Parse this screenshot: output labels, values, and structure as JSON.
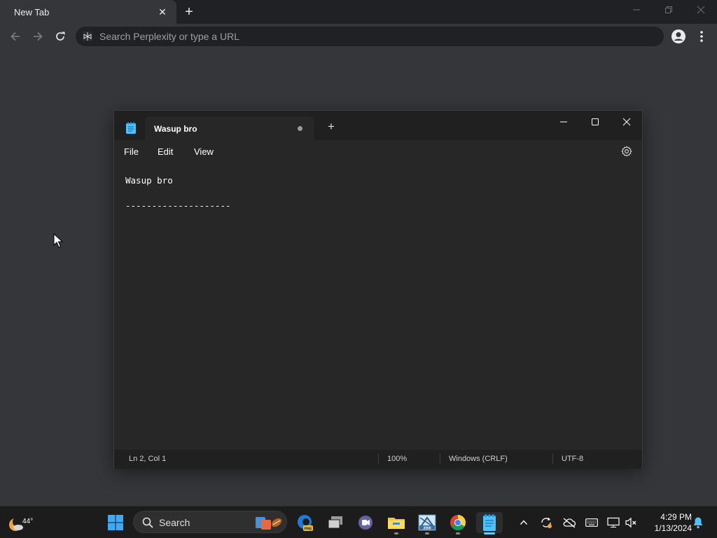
{
  "browser": {
    "tab_title": "New Tab",
    "omnibox_placeholder": "Search Perplexity or type a URL"
  },
  "notepad": {
    "tab_title": "Wasup bro",
    "menu": [
      "File",
      "Edit",
      "View"
    ],
    "content": "Wasup bro\n\n--------------------",
    "status": {
      "position": "Ln 2, Col 1",
      "zoom": "100%",
      "line_ending": "Windows (CRLF)",
      "encoding": "UTF-8"
    }
  },
  "taskbar": {
    "weather_temp": "44°",
    "search_label": "Search",
    "time": "4:29 PM",
    "date": "1/13/2024",
    "apps": [
      "start-icon",
      "edge-dev-icon",
      "task-view-icon",
      "teams-icon",
      "file-explorer-icon",
      "app-2000-icon",
      "chrome-icon",
      "notepad-icon"
    ]
  },
  "colors": {
    "chrome_frame": "#202124",
    "chrome_toolbar": "#35363a",
    "notepad_bg": "#272727",
    "taskbar_bg": "#1c1c1c",
    "accent": "#60cdff"
  }
}
